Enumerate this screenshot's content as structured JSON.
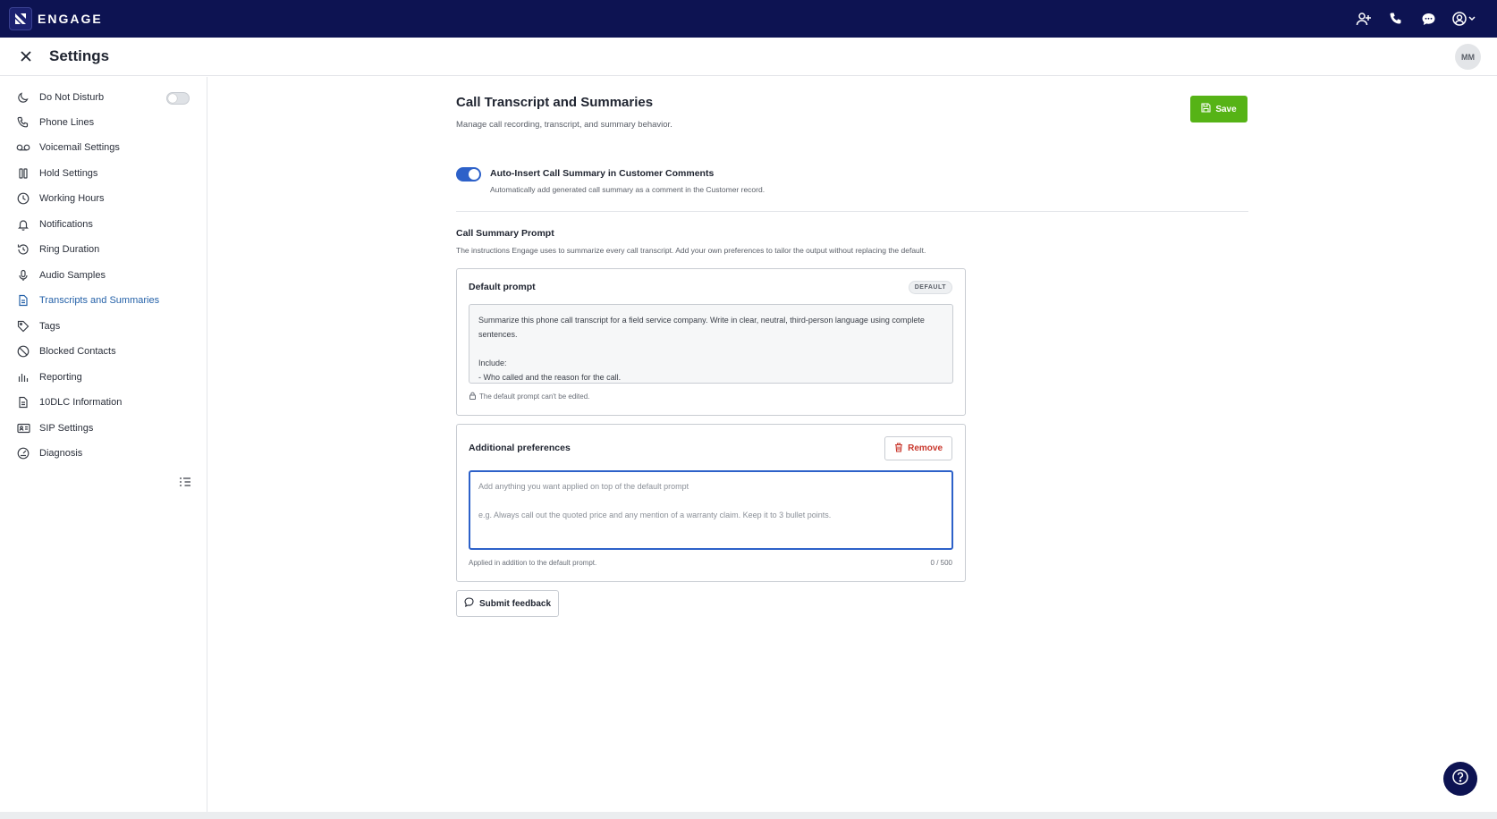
{
  "app": {
    "brand_name": "ENGAGE"
  },
  "topnav": {
    "icons": [
      "add-contact-icon",
      "phone-icon",
      "chat-icon",
      "account-icon"
    ]
  },
  "header": {
    "title": "Settings",
    "avatar_initials": "MM"
  },
  "sidebar": {
    "items": [
      {
        "label": "Do Not Disturb",
        "icon": "moon-icon",
        "toggle_on": false
      },
      {
        "label": "Phone Lines",
        "icon": "phone-icon"
      },
      {
        "label": "Voicemail Settings",
        "icon": "voicemail-icon"
      },
      {
        "label": "Hold Settings",
        "icon": "pause-icon"
      },
      {
        "label": "Working Hours",
        "icon": "clock-icon"
      },
      {
        "label": "Notifications",
        "icon": "bell-icon"
      },
      {
        "label": "Ring Duration",
        "icon": "history-icon"
      },
      {
        "label": "Audio Samples",
        "icon": "microphone-icon"
      },
      {
        "label": "Transcripts and Summaries",
        "icon": "document-icon",
        "active": true
      },
      {
        "label": "Tags",
        "icon": "tag-icon"
      },
      {
        "label": "Blocked Contacts",
        "icon": "block-icon"
      },
      {
        "label": "Reporting",
        "icon": "bar-chart-icon"
      },
      {
        "label": "10DLC Information",
        "icon": "document-icon"
      },
      {
        "label": "SIP Settings",
        "icon": "id-card-icon"
      },
      {
        "label": "Diagnosis",
        "icon": "gauge-icon"
      }
    ]
  },
  "main": {
    "title": "Call Transcript and Summaries",
    "subtitle": "Manage call recording, transcript, and summary behavior.",
    "save_label": "Save",
    "auto_insert": {
      "label": "Auto-Insert Call Summary in Customer Comments",
      "description": "Automatically add generated call summary as a comment in the Customer record.",
      "enabled": true
    },
    "prompt_section": {
      "title": "Call Summary Prompt",
      "description": "The instructions Engage uses to summarize every call transcript. Add your own preferences to tailor the output without replacing the default."
    },
    "default_prompt": {
      "title": "Default prompt",
      "badge": "DEFAULT",
      "text": "Summarize this phone call transcript for a field service company. Write in clear, neutral, third-person language using complete sentences.\n\nInclude:\n- Who called and the reason for the call.",
      "lock_note": "The default prompt can't be edited."
    },
    "additional": {
      "title": "Additional preferences",
      "remove_label": "Remove",
      "value": "",
      "placeholder": "Add anything you want applied on top of the default prompt\n\ne.g. Always call out the quoted price and any mention of a warranty claim. Keep it to 3 bullet points.",
      "applied_note": "Applied in addition to the default prompt.",
      "counter": "0 / 500"
    },
    "feedback_label": "Submit feedback"
  },
  "colors": {
    "nav_bg": "#0d1352",
    "accent_blue": "#2d61c9",
    "active_link": "#2461a8",
    "save_green": "#56b316",
    "remove_red": "#c9372c"
  }
}
